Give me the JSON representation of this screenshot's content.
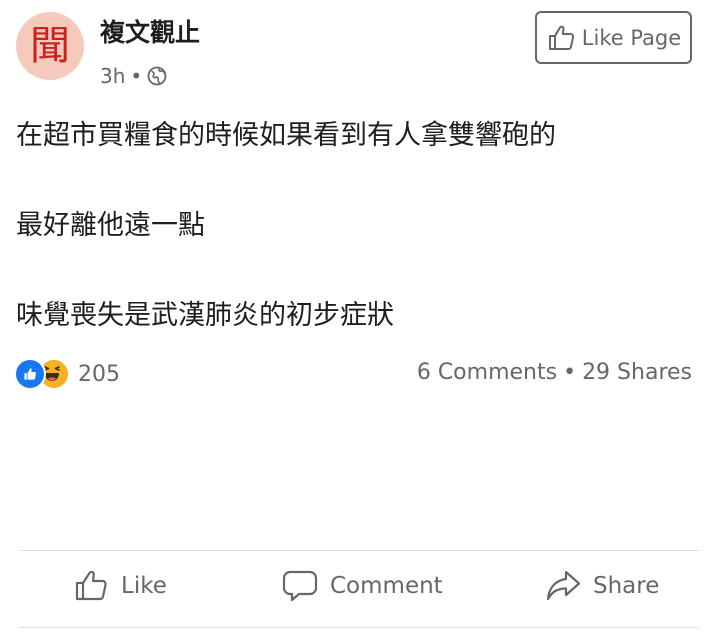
{
  "post": {
    "page_name": "複文觀止",
    "avatar_text": "聞",
    "time_ago": "3h",
    "meta_separator": "•",
    "privacy_icon": "globe-icon",
    "like_page_label": "Like Page",
    "text_lines": [
      "在超市買糧食的時候如果看到有人拿雙響砲的",
      "最好離他遠一點",
      "味覺喪失是武漢肺炎的初步症狀"
    ]
  },
  "stats": {
    "reaction_icons": [
      "like-reaction-icon",
      "haha-reaction-icon"
    ],
    "reaction_count": "205",
    "comments": "6 Comments",
    "separator": "•",
    "shares": "29 Shares"
  },
  "actions": {
    "like_label": "Like",
    "comment_label": "Comment",
    "share_label": "Share"
  },
  "colors": {
    "avatar_bg": "#f6c9bd",
    "avatar_glyph": "#c8231c",
    "like_blue": "#1877f2",
    "haha_yellow": "#f7b125",
    "secondary_text": "#65676b"
  }
}
